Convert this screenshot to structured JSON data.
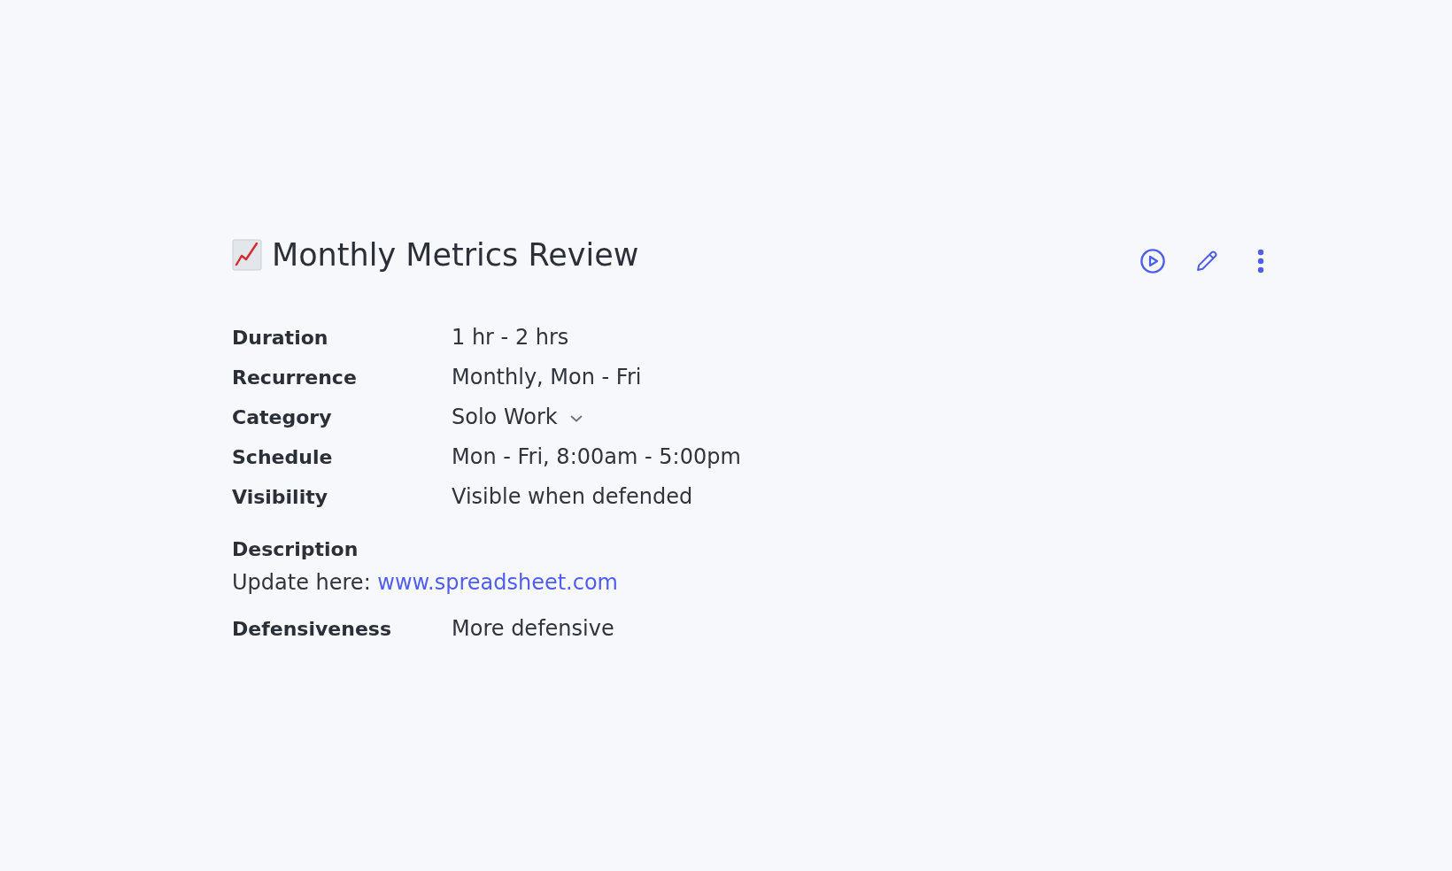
{
  "title": "Monthly Metrics Review",
  "details": [
    {
      "label": "Duration",
      "value": "1 hr - 2 hrs",
      "kind": "text"
    },
    {
      "label": "Recurrence",
      "value": "Monthly, Mon - Fri",
      "kind": "text"
    },
    {
      "label": "Category",
      "value": "Solo Work",
      "kind": "dropdown"
    },
    {
      "label": "Schedule",
      "value": "Mon - Fri, 8:00am - 5:00pm",
      "kind": "text"
    },
    {
      "label": "Visibility",
      "value": "Visible when defended",
      "kind": "text"
    }
  ],
  "description": {
    "label": "Description",
    "text": "Update here: ",
    "link": "www.spreadsheet.com"
  },
  "defensiveness": {
    "label": "Defensiveness",
    "value": "More defensive"
  }
}
